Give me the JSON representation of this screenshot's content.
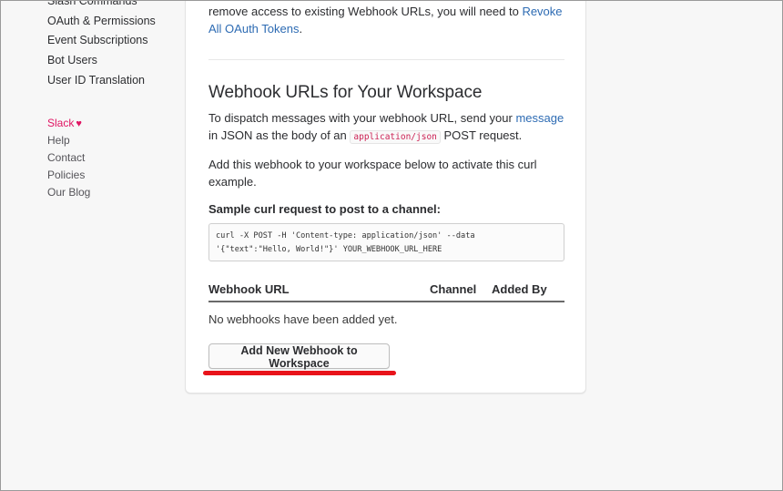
{
  "sidebar": {
    "nav_items": [
      {
        "label": "Slash Commands"
      },
      {
        "label": "OAuth & Permissions"
      },
      {
        "label": "Event Subscriptions"
      },
      {
        "label": "Bot Users"
      },
      {
        "label": "User ID Translation"
      }
    ],
    "footer_items": [
      {
        "label": "Slack",
        "icon": "heart-icon"
      },
      {
        "label": "Help"
      },
      {
        "label": "Contact"
      },
      {
        "label": "Policies"
      },
      {
        "label": "Our Blog"
      }
    ]
  },
  "main": {
    "intro_text": "remove access to existing Webhook URLs, you will need to ",
    "intro_link": "Revoke All OAuth Tokens",
    "intro_end": ".",
    "section_title": "Webhook URLs for Your Workspace",
    "desc1_before": "To dispatch messages with your webhook URL, send your ",
    "desc1_link": "message",
    "desc1_mid": " in JSON as the body of an ",
    "desc1_code": "application/json",
    "desc1_after": " POST request.",
    "desc2": "Add this webhook to your workspace below to activate this curl example.",
    "sample_label": "Sample curl request to post to a channel:",
    "code_line1": "curl -X POST -H 'Content-type: application/json' --data",
    "code_line2": "'{\"text\":\"Hello, World!\"}' YOUR_WEBHOOK_URL_HERE",
    "table": {
      "columns": [
        "Webhook URL",
        "Channel",
        "Added By"
      ],
      "empty_message": "No webhooks have been added yet."
    },
    "add_button_label": "Add New Webhook to Workspace"
  },
  "colors": {
    "link": "#2d6bb3",
    "slack_accent": "#e01563",
    "annotation": "#e8131a"
  }
}
